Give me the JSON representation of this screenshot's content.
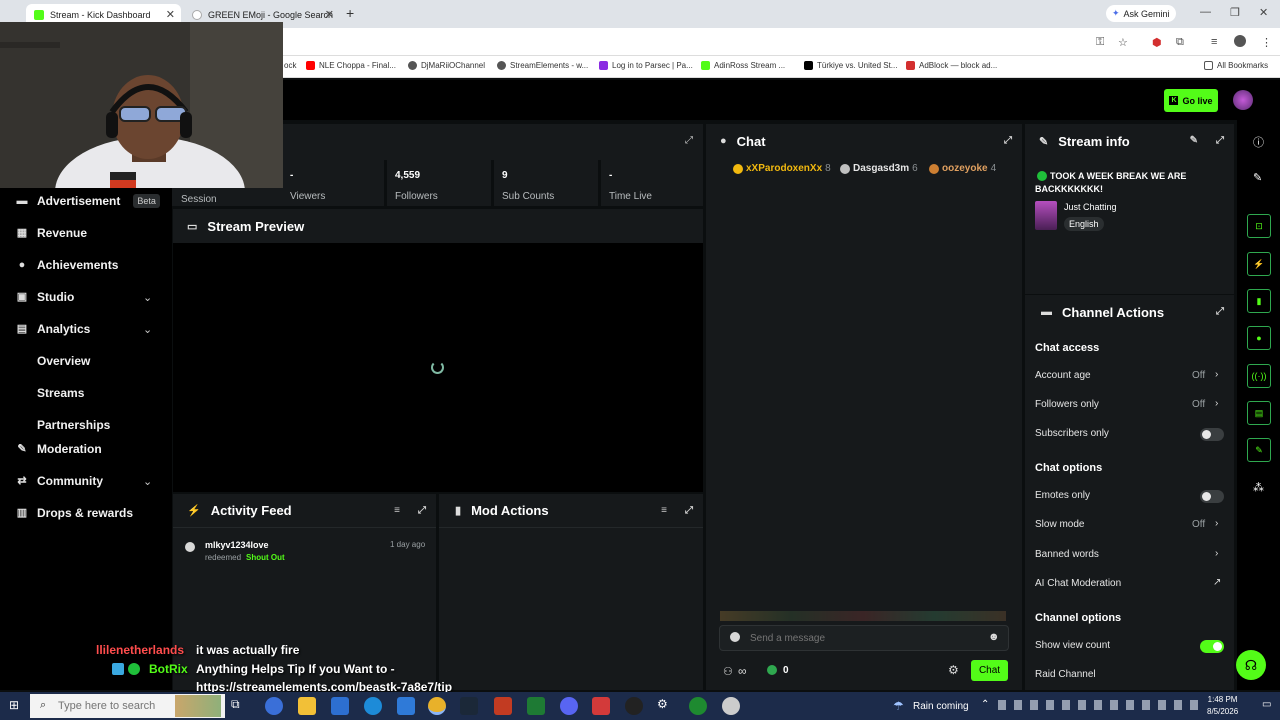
{
  "browser": {
    "tabs": [
      {
        "label": "Stream - Kick Dashboard",
        "favicon_color": "#53fc18"
      },
      {
        "label": "GREEN EMoji - Google Search",
        "favicon_color": "#ffffff"
      }
    ],
    "new_tab": "+",
    "ask_gemini": "Ask Gemini",
    "bookmarks": [
      {
        "label": "ock",
        "color": "#888888"
      },
      {
        "label": "NLE Choppa - Final...",
        "color": "#ff0000"
      },
      {
        "label": "DjMaRiiOChannel",
        "color": "#555555"
      },
      {
        "label": "StreamElements - w...",
        "color": "#555555"
      },
      {
        "label": "Log in to Parsec | Pa...",
        "color": "#8a2be2"
      },
      {
        "label": "AdinRoss Stream ...",
        "color": "#53fc18"
      },
      {
        "label": "Türkiye vs. United St...",
        "color": "#000000"
      },
      {
        "label": "AdBlock — block ad...",
        "color": "#d32f2f"
      }
    ],
    "all_bookmarks": "All Bookmarks"
  },
  "header": {
    "go_live": "Go live"
  },
  "sidebar": {
    "items": [
      {
        "label": "Advertisement",
        "badge": "Beta",
        "icon": "megaphone-icon"
      },
      {
        "label": "Revenue",
        "icon": "revenue-icon"
      },
      {
        "label": "Achievements",
        "icon": "trophy-icon"
      },
      {
        "label": "Studio",
        "icon": "studio-icon",
        "expandable": true
      },
      {
        "label": "Analytics",
        "icon": "analytics-icon",
        "expandable": true
      },
      {
        "label": "Overview",
        "sub": true
      },
      {
        "label": "Streams",
        "sub": true
      },
      {
        "label": "Partnerships",
        "sub": true
      },
      {
        "label": "Moderation",
        "icon": "wrench-icon"
      },
      {
        "label": "Community",
        "icon": "community-icon",
        "expandable": true
      },
      {
        "label": "Drops & rewards",
        "icon": "drops-icon"
      }
    ]
  },
  "stats": [
    {
      "label": "Session",
      "value": ""
    },
    {
      "label": "Viewers",
      "value": "-"
    },
    {
      "label": "Followers",
      "value": "4,559"
    },
    {
      "label": "Sub Counts",
      "value": "9"
    },
    {
      "label": "Time Live",
      "value": "-"
    }
  ],
  "stream_preview": {
    "title": "Stream Preview"
  },
  "activity_feed": {
    "title": "Activity Feed",
    "items": [
      {
        "user": "mlkyv1234love",
        "action": "redeemed",
        "reward": "Shout Out",
        "time": "1 day ago"
      }
    ]
  },
  "mod_actions": {
    "title": "Mod Actions"
  },
  "chat": {
    "title": "Chat",
    "top_chatters": [
      {
        "name": "xXParodoxenXx",
        "count": "8",
        "color": "#f2b90f"
      },
      {
        "name": "Dasgasd3m",
        "count": "6",
        "color": "#c0c0c0"
      },
      {
        "name": "oozeyoke",
        "count": "4",
        "color": "#cd7f32"
      }
    ],
    "input_placeholder": "Send a message",
    "viewer_symbol": "∞",
    "points": "0",
    "send_label": "Chat"
  },
  "stream_info": {
    "title": "Stream info",
    "stream_title": "TOOK A WEEK BREAK WE ARE BACKKKKKKK!",
    "category": "Just Chatting",
    "language": "English"
  },
  "channel_actions": {
    "title": "Channel Actions",
    "chat_access_heading": "Chat access",
    "account_age": {
      "label": "Account age",
      "value": "Off"
    },
    "followers_only": {
      "label": "Followers only",
      "value": "Off"
    },
    "subscribers_only": {
      "label": "Subscribers only",
      "on": false
    },
    "chat_options_heading": "Chat options",
    "emotes_only": {
      "label": "Emotes only",
      "on": false
    },
    "slow_mode": {
      "label": "Slow mode",
      "value": "Off"
    },
    "banned_words": {
      "label": "Banned words"
    },
    "ai_moderation": {
      "label": "AI Chat Moderation"
    },
    "channel_options_heading": "Channel options",
    "show_view_count": {
      "label": "Show view count",
      "on": true
    },
    "raid_channel": {
      "label": "Raid Channel"
    }
  },
  "overlay_chat": [
    {
      "user": "llilenetherlands",
      "user_color": "#ff4d4d",
      "message": "it was actually fire"
    },
    {
      "user": "BotRix",
      "user_color": "#53fc18",
      "message": "Anything Helps Tip If you Want to -"
    },
    {
      "user": "",
      "user_color": "#ffffff",
      "message": "https://streamelements.com/beastk-7a8e7/tip"
    }
  ],
  "taskbar": {
    "search_placeholder": "Type here to search",
    "weather": "Rain coming",
    "time": "1:48 PM",
    "date": "8/5/2026"
  }
}
